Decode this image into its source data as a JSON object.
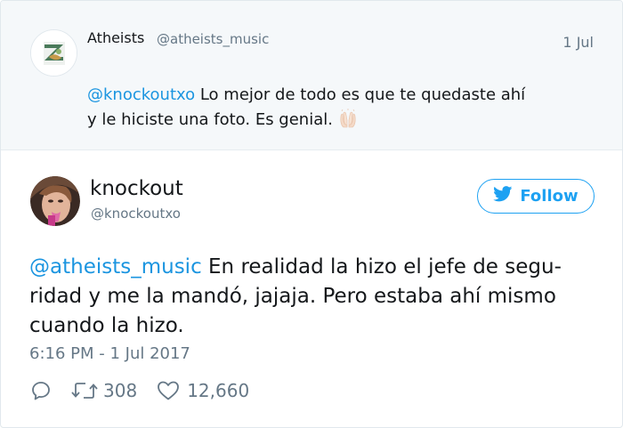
{
  "parent_tweet": {
    "name": "Atheists",
    "handle": "@atheists_music",
    "date": "1 Jul",
    "mention": "@knockoutxo",
    "line1": " Lo mejor de todo es que te quedaste ahí",
    "line2": "y le hiciste una foto. Es genial.",
    "emoji_icon": "raised-hands-icon"
  },
  "main_tweet": {
    "name": "knockout",
    "handle": "@knockoutxo",
    "follow_label": "Follow",
    "mention": "@atheists_music",
    "text": " En realidad la hizo el jefe de segu-ridad y me la mandó, jajaja. Pero estaba ahí mismo cuando la hizo.",
    "timestamp": "6:16 PM - 1 Jul 2017",
    "retweets": "308",
    "likes": "12,660"
  },
  "colors": {
    "accent": "#1da1f2",
    "mention": "#1b95e0",
    "secondary_text": "#657786",
    "parent_bg": "#f5f8fa"
  }
}
